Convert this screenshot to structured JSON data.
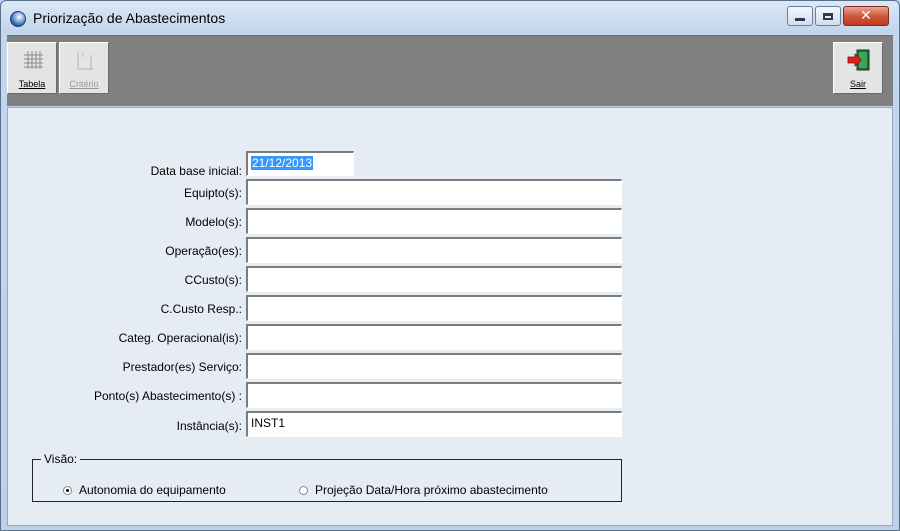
{
  "window": {
    "title": "Priorização de Abastecimentos",
    "close_glyph": "✕"
  },
  "toolbar": {
    "tabela_label": "Tabela",
    "criterio_label": "Critério",
    "sair_label": "Sair"
  },
  "form": {
    "fields": [
      {
        "label": "Data base inicial:",
        "value": "21/12/2013"
      },
      {
        "label": "Equipto(s):",
        "value": ""
      },
      {
        "label": "Modelo(s):",
        "value": ""
      },
      {
        "label": "Operação(es):",
        "value": ""
      },
      {
        "label": "CCusto(s):",
        "value": ""
      },
      {
        "label": "C.Custo Resp.:",
        "value": ""
      },
      {
        "label": "Categ. Operacional(is):",
        "value": ""
      },
      {
        "label": "Prestador(es) Serviço:",
        "value": ""
      },
      {
        "label": "Ponto(s) Abastecimento(s) :",
        "value": ""
      },
      {
        "label": "Instância(s):",
        "value": "INST1"
      }
    ]
  },
  "visao": {
    "legend": "Visão:",
    "options": [
      {
        "label": "Autonomia do equipamento",
        "checked": true
      },
      {
        "label": "Projeção Data/Hora próximo abastecimento",
        "checked": false
      }
    ]
  },
  "colors": {
    "toolbar_bg": "#808080",
    "selection": "#3399ff",
    "close_button": "#c33a22"
  }
}
